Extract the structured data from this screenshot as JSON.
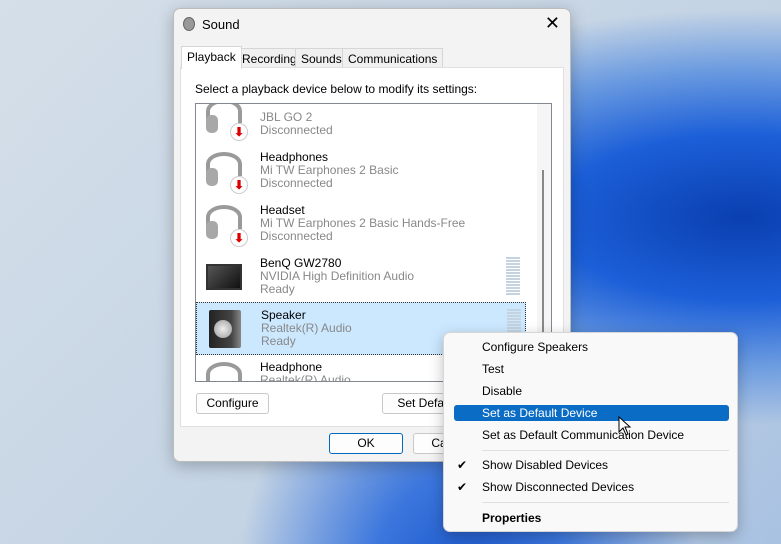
{
  "dialog": {
    "title": "Sound",
    "close": "✕",
    "tabs": [
      "Playback",
      "Recording",
      "Sounds",
      "Communications"
    ],
    "hint": "Select a playback device below to modify its settings:",
    "devices": [
      {
        "name": "",
        "desc": "JBL GO 2",
        "status": "Disconnected",
        "icon": "headphones-icon"
      },
      {
        "name": "Headphones",
        "desc": "Mi TW Earphones 2 Basic",
        "status": "Disconnected",
        "icon": "headphones-icon"
      },
      {
        "name": "Headset",
        "desc": "Mi TW Earphones 2 Basic Hands-Free",
        "status": "Disconnected",
        "icon": "headset-icon"
      },
      {
        "name": "BenQ GW2780",
        "desc": "NVIDIA High Definition Audio",
        "status": "Ready",
        "icon": "monitor-icon"
      },
      {
        "name": "Speaker",
        "desc": "Realtek(R) Audio",
        "status": "Ready",
        "icon": "speaker-icon"
      },
      {
        "name": "Headphone",
        "desc": "Realtek(R) Audio",
        "status": "",
        "icon": "headphones-icon"
      }
    ],
    "buttons": {
      "configure": "Configure",
      "set_default": "Set Default",
      "ok": "OK",
      "cancel": "Cancel"
    }
  },
  "context_menu": {
    "items": [
      "Configure Speakers",
      "Test",
      "Disable",
      "Set as Default Device",
      "Set as Default Communication Device",
      "Show Disabled Devices",
      "Show Disconnected Devices",
      "Properties"
    ],
    "check": "✔"
  }
}
